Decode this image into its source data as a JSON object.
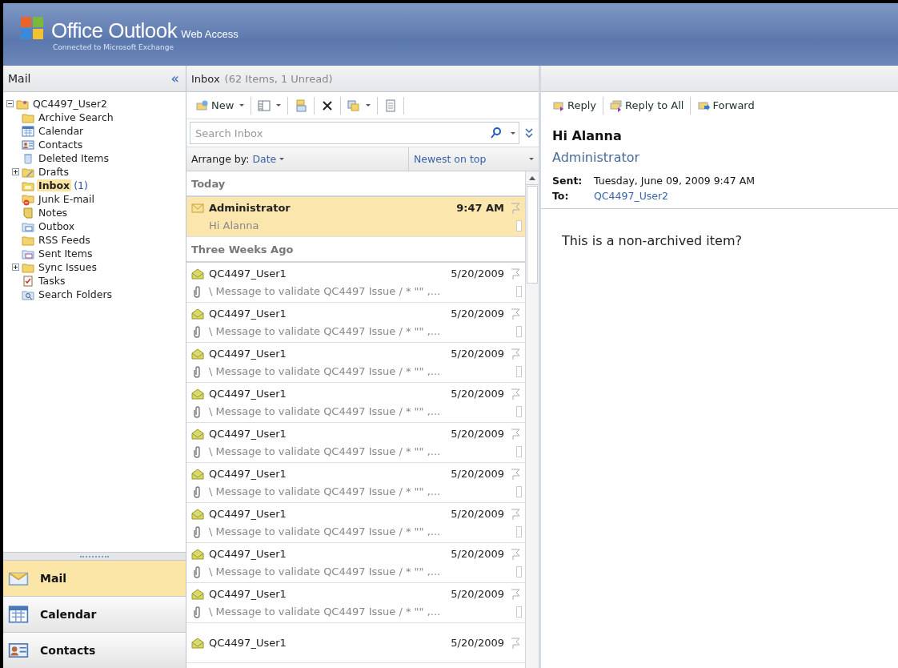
{
  "header": {
    "product": "Office Outlook",
    "suffix": "Web Access",
    "subtitle": "Connected to Microsoft Exchange"
  },
  "folder_pane": {
    "title": "Mail",
    "collapse": "«",
    "root": {
      "label": "QC4497_User2",
      "expanded": true,
      "children": [
        {
          "label": "Archive Search",
          "kind": "folder",
          "selected": false
        },
        {
          "label": "Calendar",
          "kind": "calendar",
          "selected": false
        },
        {
          "label": "Contacts",
          "kind": "contacts",
          "selected": false
        },
        {
          "label": "Deleted Items",
          "kind": "trash",
          "selected": false
        },
        {
          "label": "Drafts",
          "kind": "drafts",
          "selected": false,
          "expanded": false
        },
        {
          "label": "Inbox",
          "kind": "inbox",
          "selected": true,
          "count": "(1)"
        },
        {
          "label": "Junk E-mail",
          "kind": "junk",
          "selected": false
        },
        {
          "label": "Notes",
          "kind": "notes",
          "selected": false
        },
        {
          "label": "Outbox",
          "kind": "outbox",
          "selected": false
        },
        {
          "label": "RSS Feeds",
          "kind": "folder",
          "selected": false
        },
        {
          "label": "Sent Items",
          "kind": "sent",
          "selected": false
        },
        {
          "label": "Sync Issues",
          "kind": "folder",
          "selected": false,
          "expanded": false
        },
        {
          "label": "Tasks",
          "kind": "tasks",
          "selected": false
        },
        {
          "label": "Search Folders",
          "kind": "search",
          "selected": false
        }
      ]
    },
    "nav": [
      {
        "label": "Mail",
        "kind": "mail",
        "selected": true
      },
      {
        "label": "Calendar",
        "kind": "calendar",
        "selected": false
      },
      {
        "label": "Contacts",
        "kind": "contacts",
        "selected": false
      }
    ]
  },
  "message_list": {
    "title": "Inbox",
    "summary": "(62 Items, 1 Unread)",
    "new_label": "New",
    "search": {
      "placeholder": "Search Inbox"
    },
    "arrange_label": "Arrange by:",
    "arrange_value": "Date",
    "order": "Newest on top",
    "groups": [
      {
        "title": "Today",
        "messages": [
          {
            "sender": "Administrator",
            "date": "9:47 AM",
            "subject": "Hi Alanna",
            "unread": true,
            "selected": true,
            "attachment": false
          }
        ]
      },
      {
        "title": "Three Weeks Ago",
        "messages": [
          {
            "sender": "QC4497_User1",
            "date": "5/20/2009",
            "subject": "\\ Message to validate QC4497 Issue / * \"\" ,...",
            "unread": false,
            "selected": false,
            "attachment": true
          },
          {
            "sender": "QC4497_User1",
            "date": "5/20/2009",
            "subject": "\\ Message to validate QC4497 Issue / * \"\" ,...",
            "unread": false,
            "selected": false,
            "attachment": true
          },
          {
            "sender": "QC4497_User1",
            "date": "5/20/2009",
            "subject": "\\ Message to validate QC4497 Issue / * \"\" ,...",
            "unread": false,
            "selected": false,
            "attachment": true
          },
          {
            "sender": "QC4497_User1",
            "date": "5/20/2009",
            "subject": "\\ Message to validate QC4497 Issue / * \"\" ,...",
            "unread": false,
            "selected": false,
            "attachment": true
          },
          {
            "sender": "QC4497_User1",
            "date": "5/20/2009",
            "subject": "\\ Message to validate QC4497 Issue / * \"\" ,...",
            "unread": false,
            "selected": false,
            "attachment": true
          },
          {
            "sender": "QC4497_User1",
            "date": "5/20/2009",
            "subject": "\\ Message to validate QC4497 Issue / * \"\" ,...",
            "unread": false,
            "selected": false,
            "attachment": true
          },
          {
            "sender": "QC4497_User1",
            "date": "5/20/2009",
            "subject": "\\ Message to validate QC4497 Issue / * \"\" ,...",
            "unread": false,
            "selected": false,
            "attachment": true
          },
          {
            "sender": "QC4497_User1",
            "date": "5/20/2009",
            "subject": "\\ Message to validate QC4497 Issue / * \"\" ,...",
            "unread": false,
            "selected": false,
            "attachment": true
          },
          {
            "sender": "QC4497_User1",
            "date": "5/20/2009",
            "subject": "\\ Message to validate QC4497 Issue / * \"\" ,...",
            "unread": false,
            "selected": false,
            "attachment": true
          },
          {
            "sender": "QC4497_User1",
            "date": "5/20/2009",
            "unread": false,
            "selected": false
          }
        ]
      }
    ]
  },
  "reading_pane": {
    "toolbar": [
      {
        "label": "Reply",
        "kind": "reply"
      },
      {
        "label": "Reply to All",
        "kind": "reply-all"
      },
      {
        "label": "Forward",
        "kind": "forward"
      }
    ],
    "subject": "Hi Alanna",
    "from": "Administrator",
    "fields": [
      {
        "label": "Sent:",
        "value": "Tuesday, June 09, 2009 9:47 AM",
        "kind": "text"
      },
      {
        "label": "To:",
        "value": "QC4497_User2",
        "kind": "link"
      }
    ],
    "body": "This is a non-archived item?"
  }
}
